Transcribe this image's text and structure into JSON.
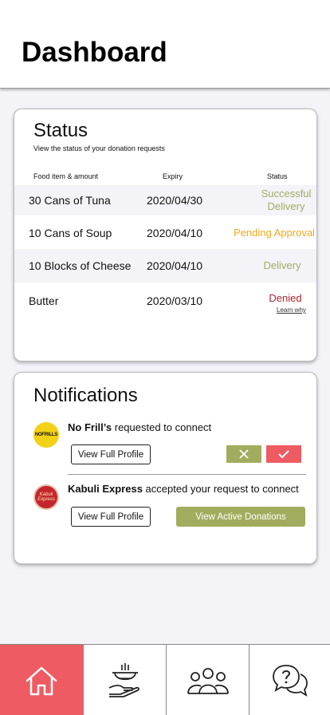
{
  "header": {
    "title": "Dashboard"
  },
  "status": {
    "title": "Status",
    "subtitle": "View the status of your donation requests",
    "columns": {
      "food": "Food item & amount",
      "expiry": "Expiry",
      "status": "Status"
    },
    "rows": [
      {
        "food": "30 Cans of Tuna",
        "expiry": "2020/04/30",
        "status_line1": "Successful",
        "status_line2": "Delivery",
        "status_color": "#a2ac5e"
      },
      {
        "food": "10 Cans of Soup",
        "expiry": "2020/04/10",
        "status_line1": "Pending Approval",
        "status_color": "#f0a81c"
      },
      {
        "food": "10 Blocks of Cheese",
        "expiry": "2020/04/10",
        "status_line1": "Delivery",
        "status_color": "#a2ac5e"
      },
      {
        "food": "Butter",
        "expiry": "2020/03/10",
        "status_line1": "Denied",
        "status_color": "#b1232b",
        "link": "Learn why"
      }
    ]
  },
  "notifications": {
    "title": "Notifications",
    "items": [
      {
        "logo": "NOFRILLS",
        "name": "No Frill’s",
        "message": " requested to connect",
        "profile_button": "View Full Profile",
        "decline_icon": "close-icon",
        "accept_icon": "check-icon"
      },
      {
        "logo_line1": "Kabuli",
        "logo_line2": "Express",
        "name": "Kabuli Express",
        "message": " accepted your request to connect",
        "profile_button": "View Full Profile",
        "action_button": "View Active Donations"
      }
    ]
  },
  "tabbar": {
    "tabs": [
      {
        "icon": "home-icon",
        "active": true
      },
      {
        "icon": "food-donation-icon",
        "active": false
      },
      {
        "icon": "community-icon",
        "active": false
      },
      {
        "icon": "help-chat-icon",
        "active": false
      }
    ]
  },
  "colors": {
    "accent_red": "#ef5b62",
    "accent_green": "#a2ac5e",
    "pending_orange": "#f0a81c",
    "denied_red": "#b1232b"
  }
}
